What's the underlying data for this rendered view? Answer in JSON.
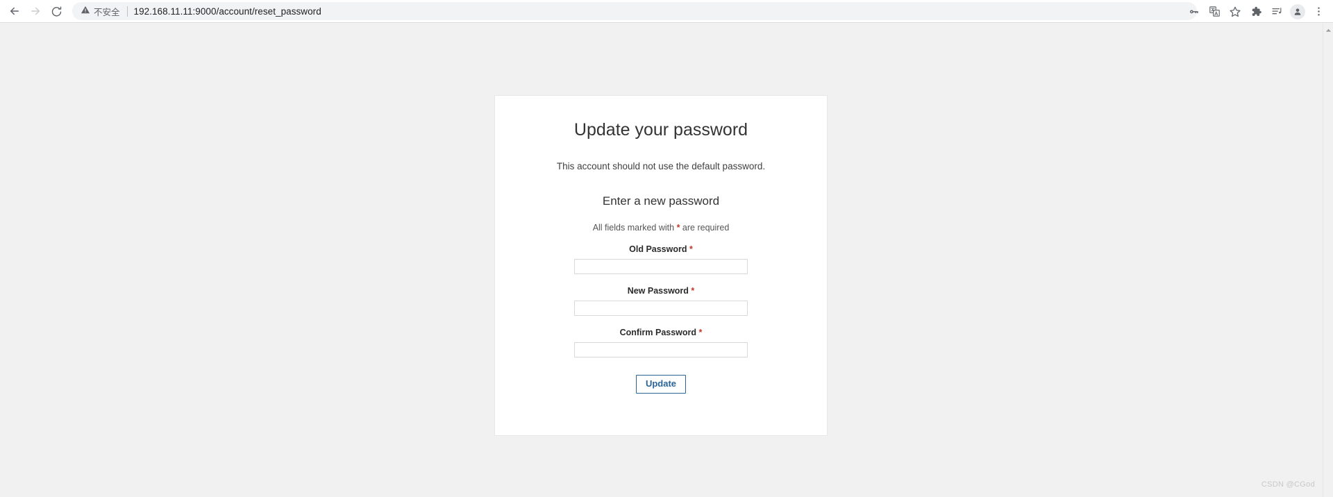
{
  "browser": {
    "nav": {
      "back_icon": "back-arrow-icon",
      "forward_icon": "forward-arrow-icon",
      "reload_icon": "reload-icon"
    },
    "omnibox": {
      "security_icon": "warning-triangle-icon",
      "security_label": "不安全",
      "url": "192.168.11.11:9000/account/reset_password"
    },
    "toolbar_icons": [
      {
        "name": "password-manager-icon",
        "glyph": "key-icon"
      },
      {
        "name": "translate-icon",
        "glyph": "translate-icon"
      },
      {
        "name": "bookmark-star-icon",
        "glyph": "star-icon"
      },
      {
        "name": "extensions-icon",
        "glyph": "puzzle-icon"
      },
      {
        "name": "reading-list-icon",
        "glyph": "list-music-icon"
      },
      {
        "name": "profile-avatar",
        "glyph": "person-icon"
      },
      {
        "name": "chrome-menu-icon",
        "glyph": "three-dots-icon"
      }
    ]
  },
  "page": {
    "title": "Update your password",
    "subtitle": "This account should not use the default password.",
    "form_heading": "Enter a new password",
    "required_note_before": "All fields marked with ",
    "required_note_star": "*",
    "required_note_after": " are required",
    "fields": [
      {
        "label": "Old Password",
        "required_marker": "*",
        "value": "",
        "placeholder": "",
        "name": "old-password-input"
      },
      {
        "label": "New Password",
        "required_marker": "*",
        "value": "",
        "placeholder": "",
        "name": "new-password-input"
      },
      {
        "label": "Confirm Password",
        "required_marker": "*",
        "value": "",
        "placeholder": "",
        "name": "confirm-password-input"
      }
    ],
    "submit_label": "Update"
  },
  "watermark": "CSDN @CGod",
  "colors": {
    "accent_blue": "#2a6496",
    "required_red": "#c0392b",
    "page_background": "#f1f1f1",
    "card_background": "#ffffff",
    "omnibox_background": "#f1f3f4"
  }
}
